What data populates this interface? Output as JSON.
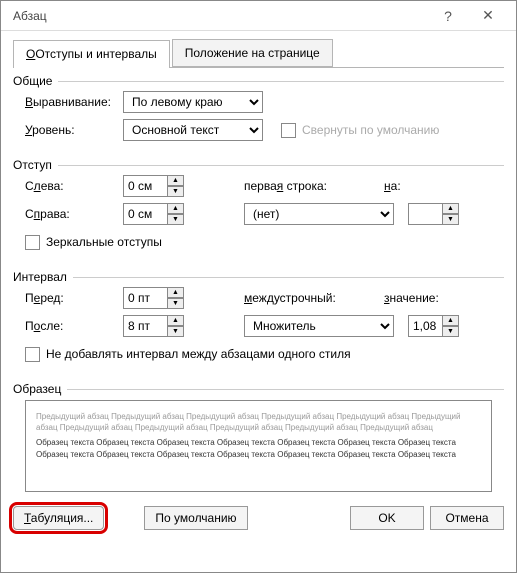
{
  "title": "Абзац",
  "tabs": {
    "t1": "Отступы и интервалы",
    "t2": "Положение на странице"
  },
  "groups": {
    "common": "Общие",
    "indent": "Отступ",
    "interval": "Интервал",
    "sample": "Образец"
  },
  "common": {
    "align_lbl": "Выравнивание:",
    "align_val": "По левому краю",
    "level_lbl": "Уровень:",
    "level_val": "Основной текст",
    "collapse": "Свернуты по умолчанию"
  },
  "indent": {
    "left_lbl": "Слева:",
    "left_val": "0 см",
    "right_lbl": "Справа:",
    "right_val": "0 см",
    "first_lbl": "первая строка:",
    "first_val": "(нет)",
    "on_lbl": "на:",
    "mirror": "Зеркальные отступы"
  },
  "interval": {
    "before_lbl": "Перед:",
    "before_val": "0 пт",
    "after_lbl": "После:",
    "after_val": "8 пт",
    "spacing_lbl": "междустрочный:",
    "spacing_val": "Множитель",
    "value_lbl": "значение:",
    "value_val": "1,08",
    "nospace": "Не добавлять интервал между абзацами одного стиля"
  },
  "preview": {
    "prev": "Предыдущий абзац Предыдущий абзац Предыдущий абзац Предыдущий абзац Предыдущий абзац Предыдущий абзац Предыдущий абзац Предыдущий абзац Предыдущий абзац Предыдущий абзац Предыдущий абзац",
    "sample": "Образец текста Образец текста Образец текста Образец текста Образец текста Образец текста Образец текста Образец текста Образец текста Образец текста Образец текста Образец текста Образец текста Образец текста"
  },
  "buttons": {
    "tabs": "Табуляция...",
    "default": "По умолчанию",
    "ok": "OK",
    "cancel": "Отмена"
  }
}
